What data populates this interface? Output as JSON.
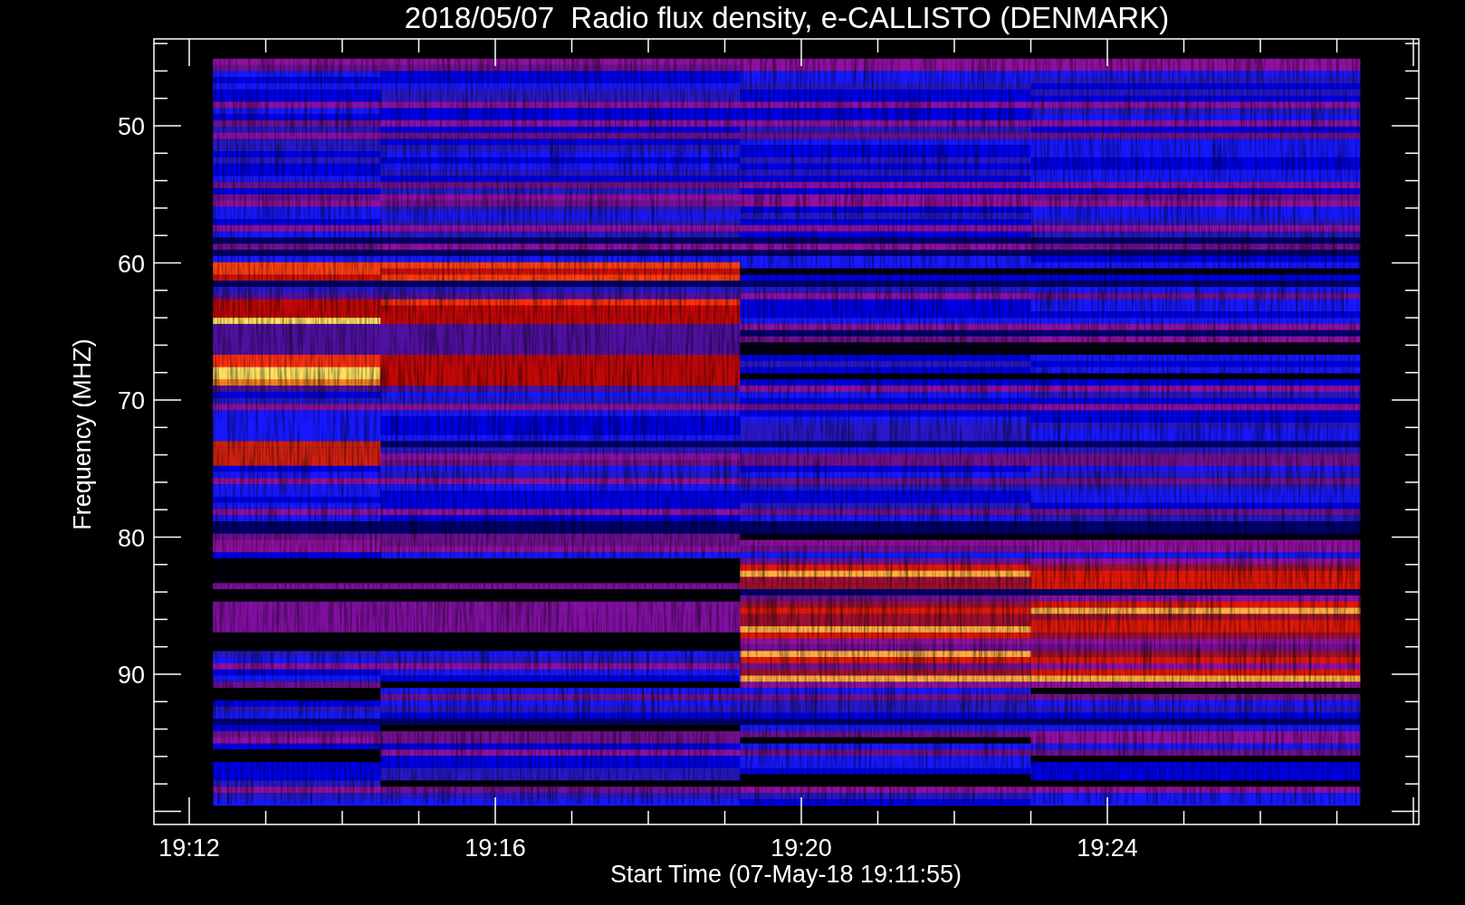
{
  "title": "2018/05/07  Radio flux density, e-CALLISTO (DENMARK)",
  "plot": {
    "y_axis": {
      "label": "Frequency (MHZ)",
      "ticks": [
        "50",
        "60",
        "70",
        "80",
        "90"
      ]
    },
    "x_axis": {
      "label": "Start Time (07-May-18 19:11:55)",
      "ticks": [
        "19:12",
        "19:16",
        "19:20",
        "19:24"
      ]
    }
  }
}
